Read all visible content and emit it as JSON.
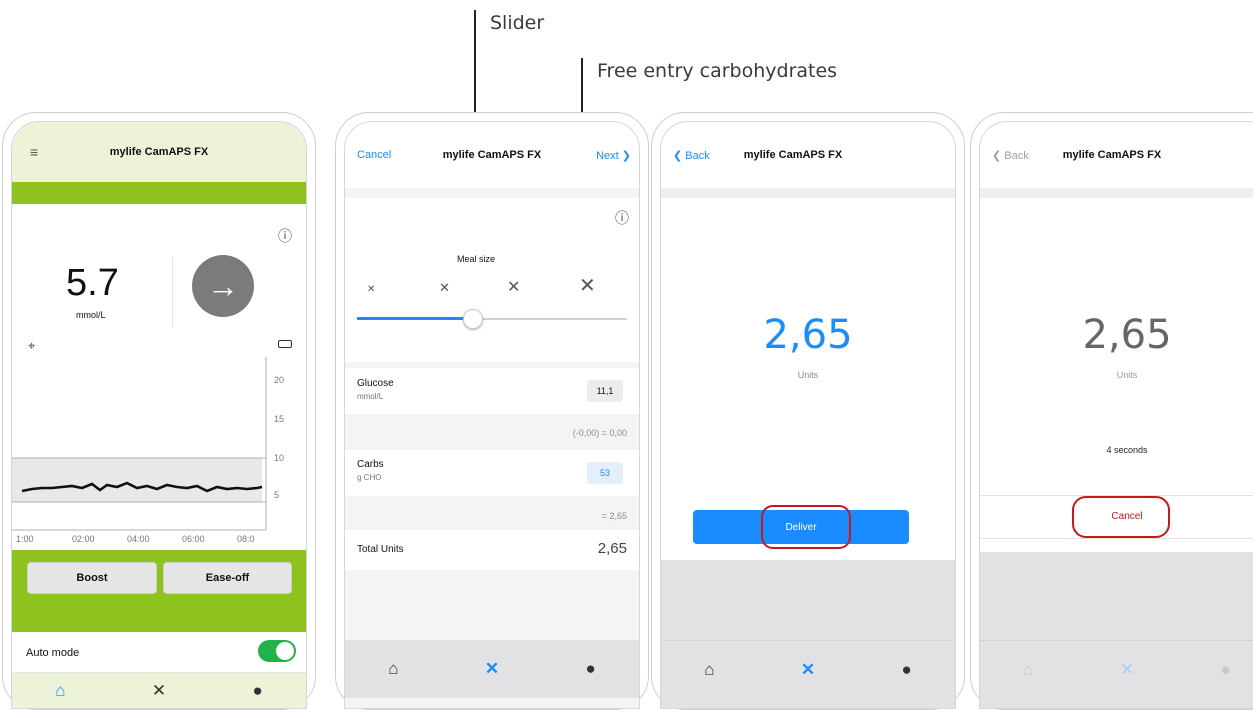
{
  "callouts": {
    "slider": "Slider",
    "free_entry": "Free entry carbohydrates"
  },
  "app_title": "mylife CamAPS FX",
  "screen1": {
    "glucose_value": "5.7",
    "glucose_unit": "mmol/L",
    "y_ticks": [
      "20",
      "15",
      "10",
      "5"
    ],
    "x_ticks": [
      "1:00",
      "02:00",
      "04:00",
      "06:00",
      "08:0"
    ],
    "boost_label": "Boost",
    "easeoff_label": "Ease-off",
    "auto_mode_label": "Auto mode",
    "auto_mode_on": true,
    "accent_color": "#8dc21f"
  },
  "screen2": {
    "cancel_label": "Cancel",
    "next_label": "Next",
    "meal_size_label": "Meal size",
    "slider_level": 0.5,
    "glucose_label": "Glucose",
    "glucose_unit": "mmol/L",
    "glucose_value": "11,1",
    "glucose_calc": "(-0,00) = 0,00",
    "carbs_label": "Carbs",
    "carbs_unit": "g CHO",
    "carbs_value": "53",
    "carbs_calc": "= 2,65",
    "total_label": "Total Units",
    "total_value": "2,65"
  },
  "screen3": {
    "back_label": "Back",
    "units_value": "2,65",
    "units_label": "Units",
    "deliver_label": "Deliver"
  },
  "screen4": {
    "back_label": "Back",
    "units_value": "2,65",
    "units_label": "Units",
    "countdown": "4 seconds",
    "cancel_label": "Cancel"
  },
  "colors": {
    "blue": "#1a8cff",
    "red": "#c3191f",
    "green": "#8dc21f"
  }
}
